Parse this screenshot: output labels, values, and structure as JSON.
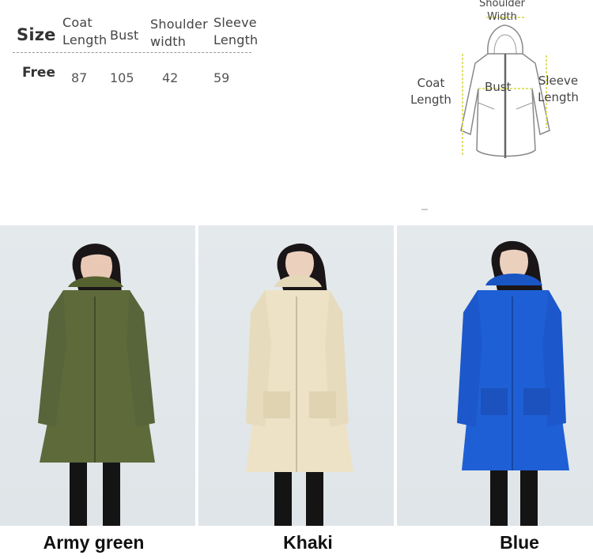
{
  "size_table": {
    "headers": {
      "size": "Size",
      "coat_length": "Coat Length",
      "bust": "Bust",
      "shoulder_width": "Shoulder width",
      "sleeve_length": "Sleeve Length"
    },
    "row": {
      "size": "Free",
      "coat_length": "87",
      "bust": "105",
      "shoulder_width": "42",
      "sleeve_length": "59"
    }
  },
  "diagram": {
    "shoulder_label": "Shoulder Width",
    "coat_label": "Coat Length",
    "bust_label": "Bust",
    "sleeve_label": "Sleeve Length"
  },
  "colors": [
    {
      "name": "Army green",
      "hex": "#5e6a3a"
    },
    {
      "name": "Khaki",
      "hex": "#ede2c6"
    },
    {
      "name": "Blue",
      "hex": "#1f5fd6"
    }
  ]
}
